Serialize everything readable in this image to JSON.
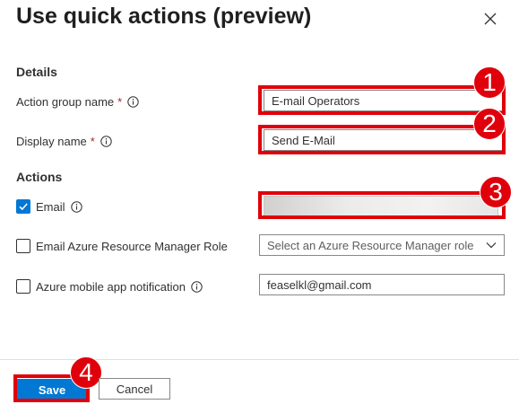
{
  "header": {
    "title": "Use quick actions (preview)",
    "close_icon": "close-icon"
  },
  "details": {
    "section_title": "Details",
    "action_group_name": {
      "label": "Action group name",
      "required": "*",
      "value": "E-mail Operators"
    },
    "display_name": {
      "label": "Display name",
      "required": "*",
      "value": "Send E-Mail"
    }
  },
  "actions": {
    "section_title": "Actions",
    "email": {
      "label": "Email",
      "checked": true,
      "value": ""
    },
    "arm_role": {
      "label": "Email Azure Resource Manager Role",
      "checked": false,
      "placeholder": "Select an Azure Resource Manager role"
    },
    "mobile": {
      "label": "Azure mobile app notification",
      "checked": false,
      "value": "feaselkl@gmail.com"
    }
  },
  "footer": {
    "save_label": "Save",
    "cancel_label": "Cancel"
  },
  "annotations": {
    "badge1": "1",
    "badge2": "2",
    "badge3": "3",
    "badge4": "4"
  },
  "colors": {
    "accent": "#0078d4",
    "highlight": "#e0000b",
    "required": "#a4262c"
  }
}
